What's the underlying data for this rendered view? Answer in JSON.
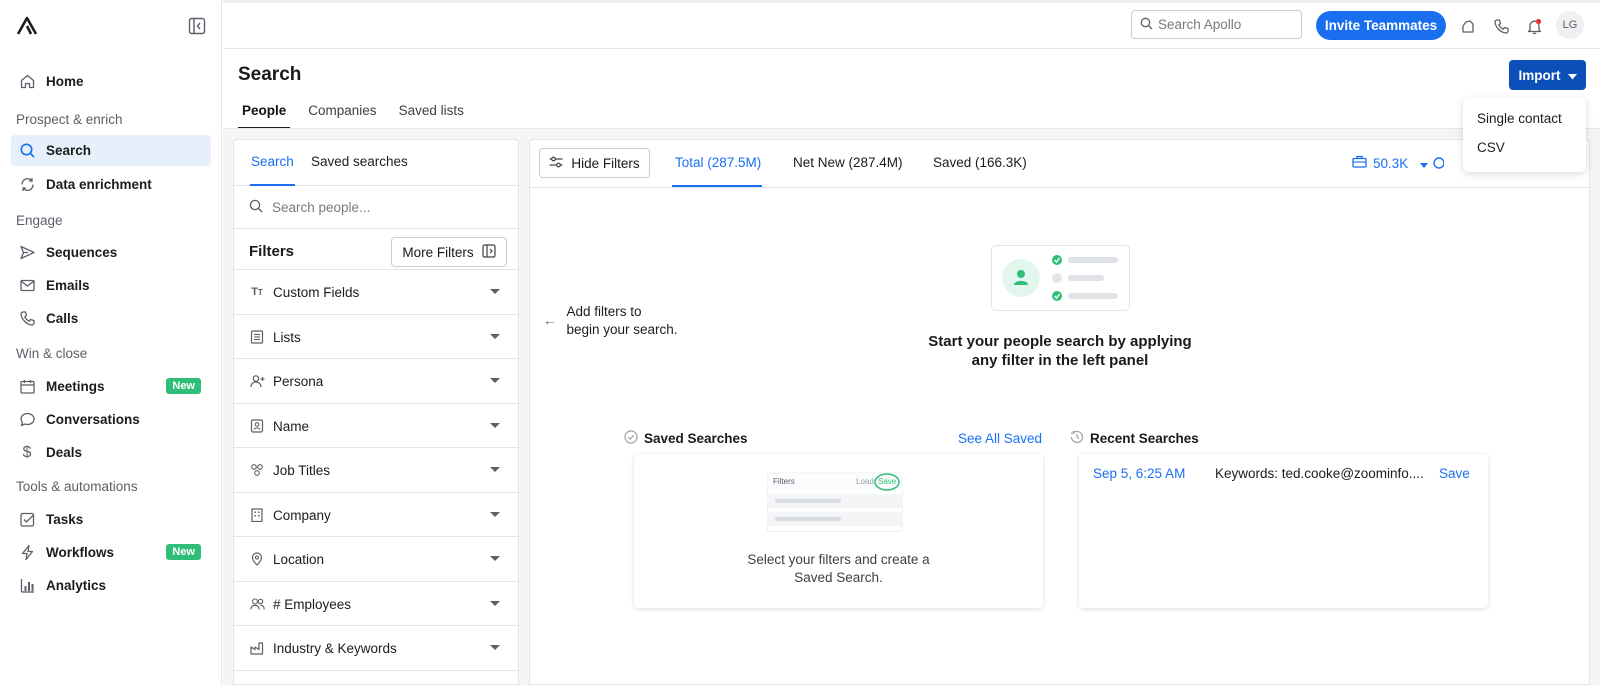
{
  "sidebar": {
    "logo_icon": "apollo-logo-icon",
    "collapse_icon": "sidebar-collapse-icon",
    "home": "Home",
    "sections": {
      "prospect": "Prospect & enrich",
      "engage": "Engage",
      "win": "Win & close",
      "tools": "Tools & automations"
    },
    "items": {
      "search": "Search",
      "data_enrichment": "Data enrichment",
      "sequences": "Sequences",
      "emails": "Emails",
      "calls": "Calls",
      "meetings": "Meetings",
      "conversations": "Conversations",
      "deals": "Deals",
      "tasks": "Tasks",
      "workflows": "Workflows",
      "analytics": "Analytics"
    },
    "new_badge": "New",
    "active_item": "Search"
  },
  "topbar": {
    "search_placeholder": "Search Apollo",
    "invite_label": "Invite Teammates",
    "avatar_initials": "LG",
    "icons": [
      "apps-icon",
      "phone-icon",
      "bell-icon"
    ]
  },
  "page": {
    "title": "Search",
    "import_label": "Import",
    "tabs": [
      "People",
      "Companies",
      "Saved lists"
    ],
    "active_tab": "People"
  },
  "import_menu": {
    "options": [
      "Single contact",
      "CSV"
    ]
  },
  "filters_panel": {
    "tabs": [
      "Search",
      "Saved searches"
    ],
    "search_placeholder": "Search people...",
    "title": "Filters",
    "more_filters_label": "More Filters",
    "filters": [
      {
        "label": "Custom Fields",
        "icon": "text-type-icon"
      },
      {
        "label": "Lists",
        "icon": "list-icon"
      },
      {
        "label": "Persona",
        "icon": "persona-icon"
      },
      {
        "label": "Name",
        "icon": "name-card-icon"
      },
      {
        "label": "Job Titles",
        "icon": "job-titles-icon"
      },
      {
        "label": "Company",
        "icon": "building-icon"
      },
      {
        "label": "Location",
        "icon": "location-pin-icon"
      },
      {
        "label": "# Employees",
        "icon": "people-icon"
      },
      {
        "label": "Industry & Keywords",
        "icon": "factory-icon"
      }
    ]
  },
  "results": {
    "hide_filters_label": "Hide Filters",
    "tabs": [
      "Total (287.5M)",
      "Net New (287.4M)",
      "Saved (166.3K)"
    ],
    "active_tab": "Total (287.5M)",
    "credits": "50.3K",
    "hint_line1": "Add filters to",
    "hint_line2": "begin your search.",
    "empty_title_line1": "Start your people search by applying",
    "empty_title_line2": "any filter in the left panel",
    "saved_searches": {
      "title": "Saved Searches",
      "see_all": "See All Saved",
      "mini_filters": "Filters",
      "mini_load": "Load",
      "mini_save": "Save",
      "text_line1": "Select your filters and create a",
      "text_line2": "Saved Search."
    },
    "recent_searches": {
      "title": "Recent Searches",
      "items": [
        {
          "date": "Sep 5, 6:25 AM",
          "keywords": "Keywords: ted.cooke@zoominfo....",
          "action": "Save"
        }
      ]
    }
  },
  "colors": {
    "primary": "#1a6ff0",
    "import": "#0c4fb8",
    "badge_new": "#2fbe77",
    "active_nav_bg": "#e6f0fb"
  }
}
